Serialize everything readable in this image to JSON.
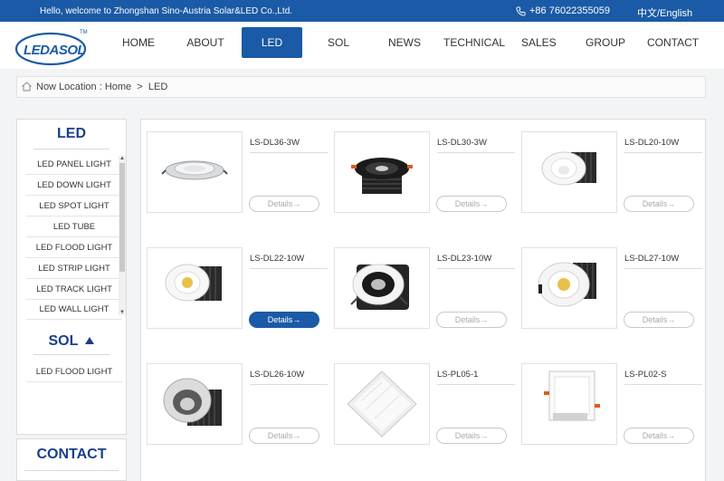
{
  "topbar": {
    "welcome": "Hello, welcome to Zhongshan Sino-Austria Solar&LED Co.,Ltd.",
    "phone": "+86 76022355059",
    "language": "中文/English"
  },
  "logo": {
    "text": "LEDASOL",
    "tm": "TM"
  },
  "nav": {
    "items": [
      {
        "label": "HOME"
      },
      {
        "label": "ABOUT"
      },
      {
        "label": "LED"
      },
      {
        "label": "SOL"
      },
      {
        "label": "NEWS"
      },
      {
        "label": "TECHNICAL"
      },
      {
        "label": "SALES"
      },
      {
        "label": "GROUP"
      },
      {
        "label": "CONTACT"
      }
    ],
    "active": "LED"
  },
  "breadcrumb": {
    "prefix": "Now Location : ",
    "home": "Home",
    "sep": ">",
    "current": "LED"
  },
  "sidebar": {
    "led_title": "LED",
    "led_items": [
      {
        "label": "LED PANEL LIGHT"
      },
      {
        "label": "LED DOWN LIGHT"
      },
      {
        "label": "LED SPOT LIGHT"
      },
      {
        "label": "LED TUBE"
      },
      {
        "label": "LED FLOOD LIGHT"
      },
      {
        "label": "LED STRIP LIGHT"
      },
      {
        "label": "LED TRACK LIGHT"
      },
      {
        "label": "LED WALL LIGHT"
      }
    ],
    "sol_title": "SOL",
    "sol_items": [
      {
        "label": "LED FLOOD LIGHT"
      }
    ],
    "contact_title": "CONTACT"
  },
  "products": [
    {
      "name": "LS-DL36-3W",
      "details": "Details",
      "type": "silver"
    },
    {
      "name": "LS-DL30-3W",
      "details": "Details",
      "type": "black"
    },
    {
      "name": "LS-DL20-10W",
      "details": "Details",
      "type": "white-deep"
    },
    {
      "name": "LS-DL22-10W",
      "details": "Details",
      "type": "white-cob",
      "active": true
    },
    {
      "name": "LS-DL23-10W",
      "details": "Details",
      "type": "white-black"
    },
    {
      "name": "LS-DL27-10W",
      "details": "Details",
      "type": "white-tilt"
    },
    {
      "name": "LS-DL26-10W",
      "details": "Details",
      "type": "white-ring"
    },
    {
      "name": "LS-PL05-1",
      "details": "Details",
      "type": "panel"
    },
    {
      "name": "LS-PL02-S",
      "details": "Details",
      "type": "square"
    }
  ],
  "colors": {
    "brand": "#1a5aa6",
    "title": "#1a3f8c"
  }
}
